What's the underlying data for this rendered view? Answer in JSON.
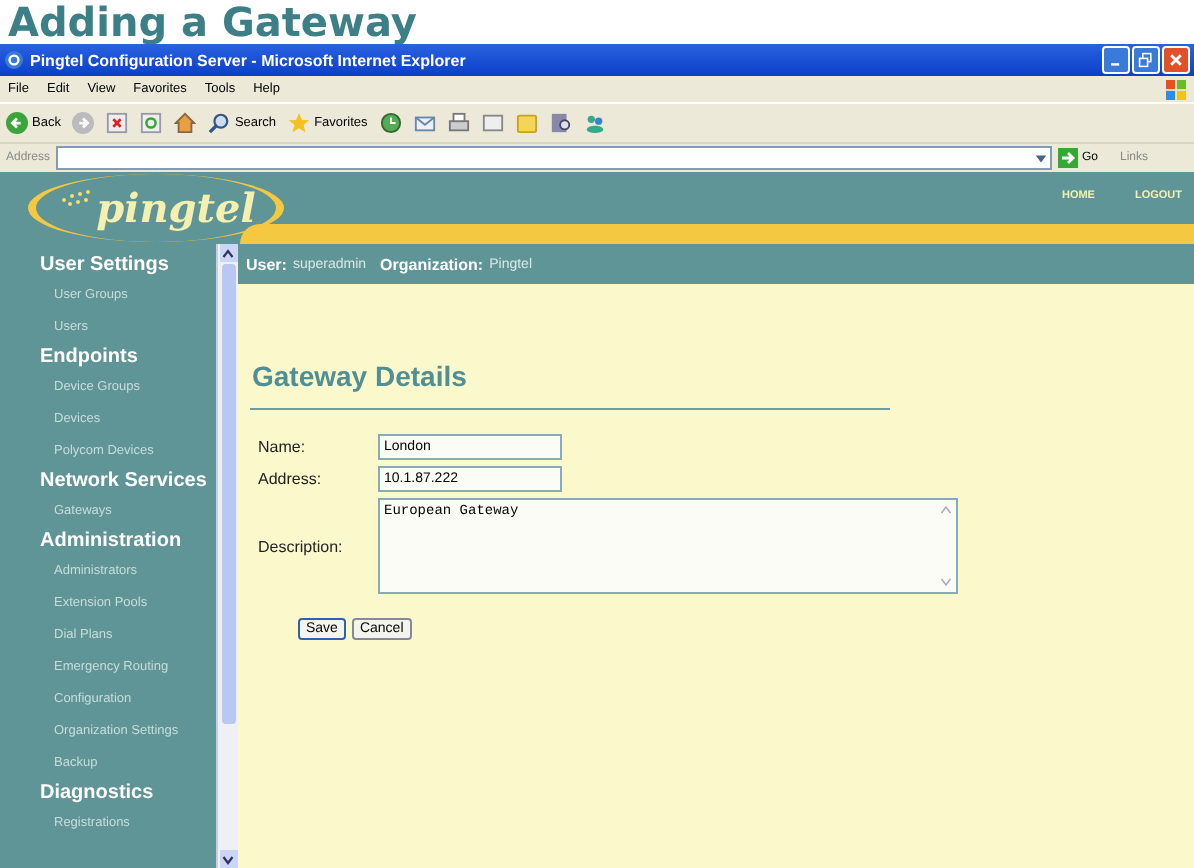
{
  "page_heading": "Adding a Gateway",
  "window": {
    "title": "Pingtel Configuration Server - Microsoft Internet Explorer"
  },
  "menu": [
    "File",
    "Edit",
    "View",
    "Favorites",
    "Tools",
    "Help"
  ],
  "toolbar": {
    "back": "Back",
    "search": "Search",
    "favorites": "Favorites"
  },
  "address_bar": {
    "label": "Address",
    "go": "Go",
    "links": "Links"
  },
  "banner": {
    "logo": "pingtel",
    "links": [
      "HOME",
      "LOGOUT"
    ]
  },
  "user_bar": {
    "user_label": "User:",
    "user": "superadmin",
    "org_label": "Organization:",
    "org": "Pingtel"
  },
  "sidebar": [
    {
      "title": "User Settings",
      "items": [
        "User Groups",
        "Users"
      ]
    },
    {
      "title": "Endpoints",
      "items": [
        "Device Groups",
        "Devices",
        "Polycom Devices"
      ]
    },
    {
      "title": "Network Services",
      "items": [
        "Gateways"
      ]
    },
    {
      "title": "Administration",
      "items": [
        "Administrators",
        "Extension Pools",
        "Dial Plans",
        "Emergency Routing",
        "Configuration",
        "Organization Settings",
        "Backup"
      ]
    },
    {
      "title": "Diagnostics",
      "items": [
        "Registrations"
      ]
    }
  ],
  "form": {
    "title": "Gateway Details",
    "fields": [
      {
        "kind": "input",
        "label": "Name:",
        "value": "London"
      },
      {
        "kind": "input",
        "label": "Address:",
        "value": "10.1.87.222"
      },
      {
        "kind": "textarea",
        "label": "Description:",
        "value": "European Gateway"
      }
    ],
    "buttons": [
      "Save",
      "Cancel"
    ]
  }
}
